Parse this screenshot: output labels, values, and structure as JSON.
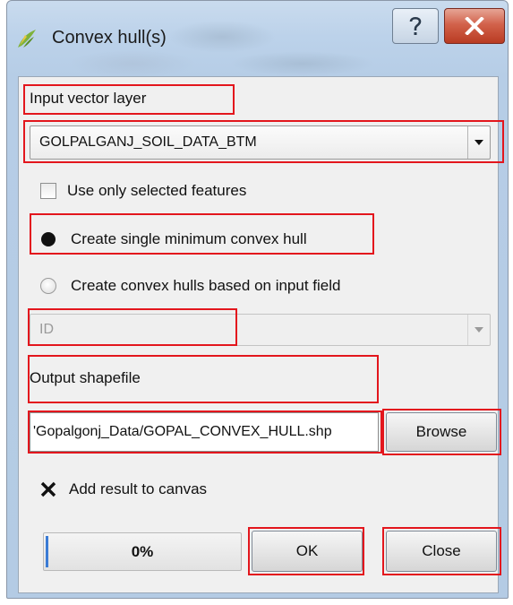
{
  "window": {
    "title": "Convex hull(s)",
    "help_glyph": "?",
    "close_glyph": "X",
    "app_icon": "qgis-icon"
  },
  "form": {
    "input_layer_label": "Input vector layer",
    "input_layer_value": "GOLPALGANJ_SOIL_DATA_BTM",
    "use_selected_label": "Use only selected features",
    "use_selected_checked": false,
    "radio_single_label": "Create single minimum convex hull",
    "radio_single_selected": true,
    "radio_field_label": "Create convex hulls based on input field",
    "radio_field_selected": false,
    "field_combo_value": "ID",
    "output_label": "Output shapefile",
    "output_value": "'Gopalgonj_Data/GOPAL_CONVEX_HULL.shp",
    "browse_label": "Browse",
    "add_to_canvas_label": "Add result to canvas",
    "add_to_canvas_checked": true
  },
  "footer": {
    "progress_text": "0%",
    "progress_value": 0,
    "ok_label": "OK",
    "close_label": "Close"
  },
  "colors": {
    "highlight": "#e3161d",
    "titlebar": "#bcd2ea",
    "close_button": "#c9452d"
  }
}
